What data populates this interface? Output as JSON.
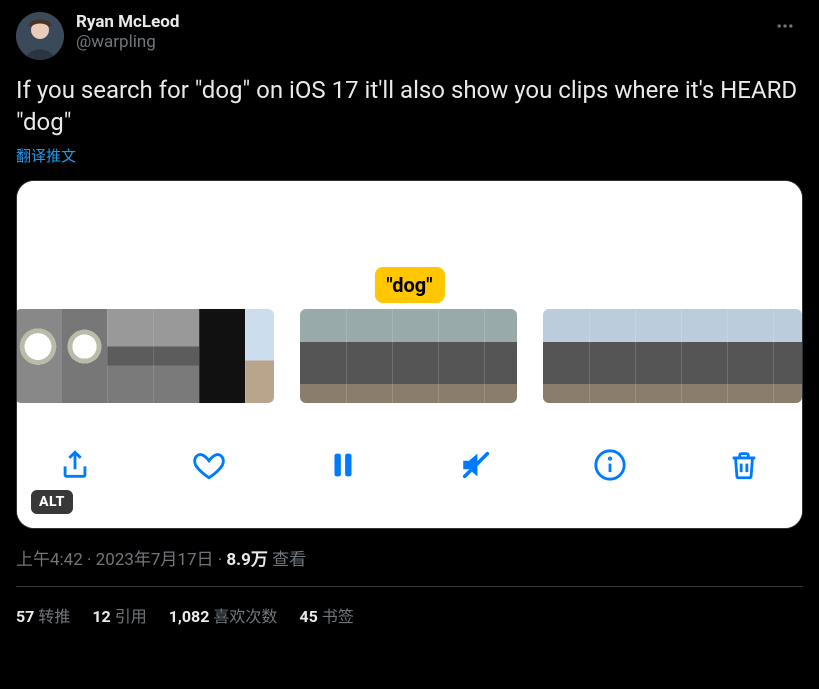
{
  "user": {
    "display_name": "Ryan McLeod",
    "handle": "@warpling"
  },
  "tweet": {
    "text": "If you search for \"dog\" on iOS 17 it'll also show you clips where it's HEARD \"dog\"",
    "translate_label": "翻译推文"
  },
  "media": {
    "caption_label": "\"dog\"",
    "alt_badge": "ALT",
    "controls": {
      "share": "share",
      "like": "like",
      "pause": "pause",
      "mute": "mute",
      "info": "info",
      "delete": "delete"
    }
  },
  "meta": {
    "time": "上午4:42",
    "date": "2023年7月17日",
    "views_count": "8.9万",
    "views_label": "查看",
    "sep": " · "
  },
  "stats": {
    "retweets": {
      "count": "57",
      "label": "转推"
    },
    "quotes": {
      "count": "12",
      "label": "引用"
    },
    "likes": {
      "count": "1,082",
      "label": "喜欢次数"
    },
    "bookmarks": {
      "count": "45",
      "label": "书签"
    }
  }
}
